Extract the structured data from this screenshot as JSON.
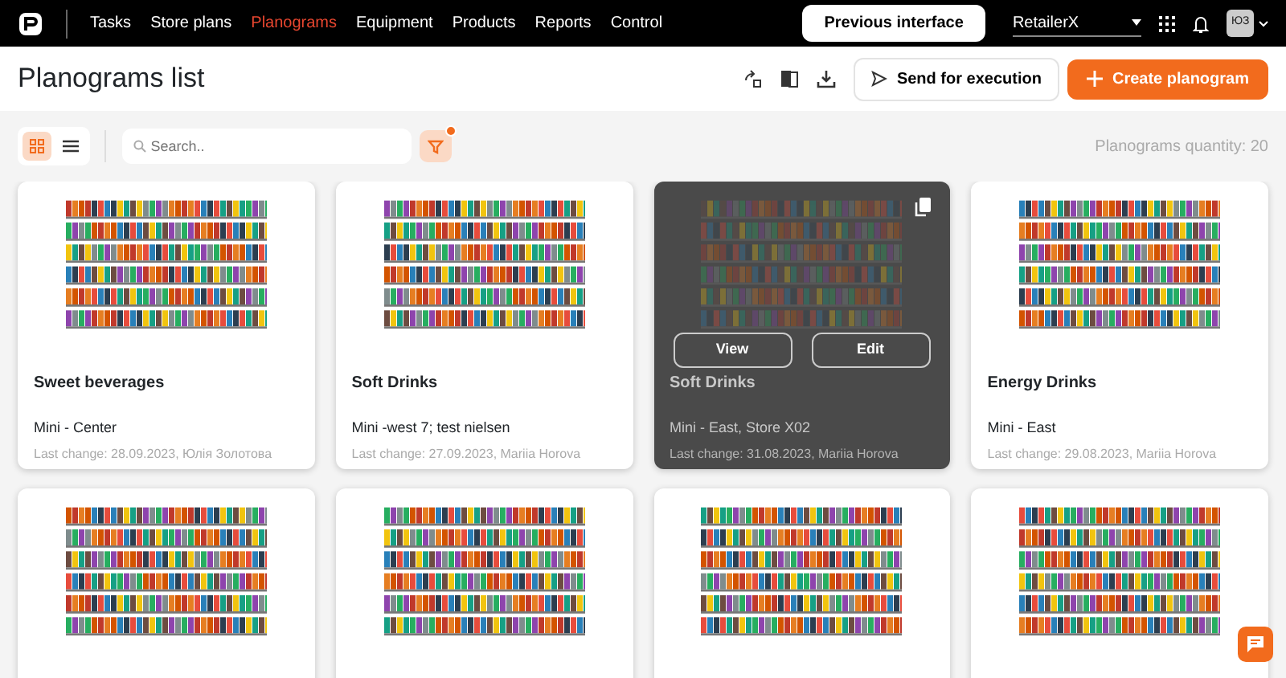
{
  "topbar": {
    "nav": [
      {
        "label": "Tasks",
        "selected": false
      },
      {
        "label": "Store plans",
        "selected": false
      },
      {
        "label": "Planograms",
        "selected": true
      },
      {
        "label": "Equipment",
        "selected": false
      },
      {
        "label": "Products",
        "selected": false
      },
      {
        "label": "Reports",
        "selected": false
      },
      {
        "label": "Control",
        "selected": false
      }
    ],
    "previous_button": "Previous interface",
    "retailer": "RetailerX",
    "avatar": "ЮЗ"
  },
  "header": {
    "title": "Planograms list",
    "send_button": "Send for execution",
    "create_button": "Create planogram"
  },
  "toolbar": {
    "views": [
      {
        "kind": "grid",
        "selected": true
      },
      {
        "kind": "list",
        "selected": false
      }
    ],
    "search": {
      "placeholder": "Search.."
    },
    "filter_active": true,
    "quantity": "Planograms quantity: 20"
  },
  "planograms": [
    {
      "title": "Sweet beverages",
      "store": "Mini - Center",
      "last_change": "Last change: 28.09.2023, Юлія Золотова",
      "hovered": false
    },
    {
      "title": "Soft Drinks",
      "store": "Mini -west 7; test nielsen",
      "last_change": "Last change: 27.09.2023, Mariia Horova",
      "hovered": false
    },
    {
      "title": "Soft Drinks",
      "store": "Mini - East, Store X02",
      "last_change": "Last change: 31.08.2023, Mariia Horova",
      "hovered": true,
      "actions": [
        "View",
        "Edit"
      ]
    },
    {
      "title": "Energy Drinks",
      "store": "Mini - East",
      "last_change": "Last change: 29.08.2023, Mariia Horova",
      "hovered": false
    },
    {
      "hovered": false
    },
    {
      "hovered": false
    },
    {
      "hovered": false
    },
    {
      "hovered": false
    }
  ]
}
